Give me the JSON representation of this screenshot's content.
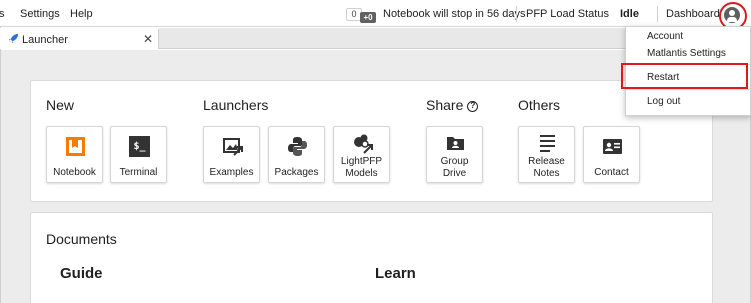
{
  "menubar": {
    "items": [
      "s",
      "Settings",
      "Help"
    ],
    "counter": "0",
    "counter_plus": "+0",
    "notice": "Notebook will stop in 56 days",
    "pfp_status": "PFP Load Status",
    "status": "Idle",
    "dashboard": "Dashboard"
  },
  "tab": {
    "label": "Launcher",
    "close": "✕"
  },
  "launcher": {
    "sections": {
      "new": "New",
      "launchers": "Launchers",
      "share": "Share",
      "others": "Others"
    },
    "cards": {
      "notebook": "Notebook",
      "terminal": "Terminal",
      "examples": "Examples",
      "packages": "Packages",
      "lightpfp_1": "LightPFP",
      "lightpfp_2": "Models",
      "group_1": "Group",
      "group_2": "Drive",
      "release_1": "Release",
      "release_2": "Notes",
      "contact": "Contact"
    },
    "terminal_glyph": "$_",
    "documents": {
      "title": "Documents",
      "guide": "Guide",
      "learn": "Learn"
    }
  },
  "dropdown": {
    "items": [
      "Account",
      "Matlantis Settings",
      "Restart",
      "Log out"
    ]
  },
  "colors": {
    "idle": "#2e9b2e",
    "highlight": "#e0191e",
    "notebook_orange": "#f57c00"
  }
}
